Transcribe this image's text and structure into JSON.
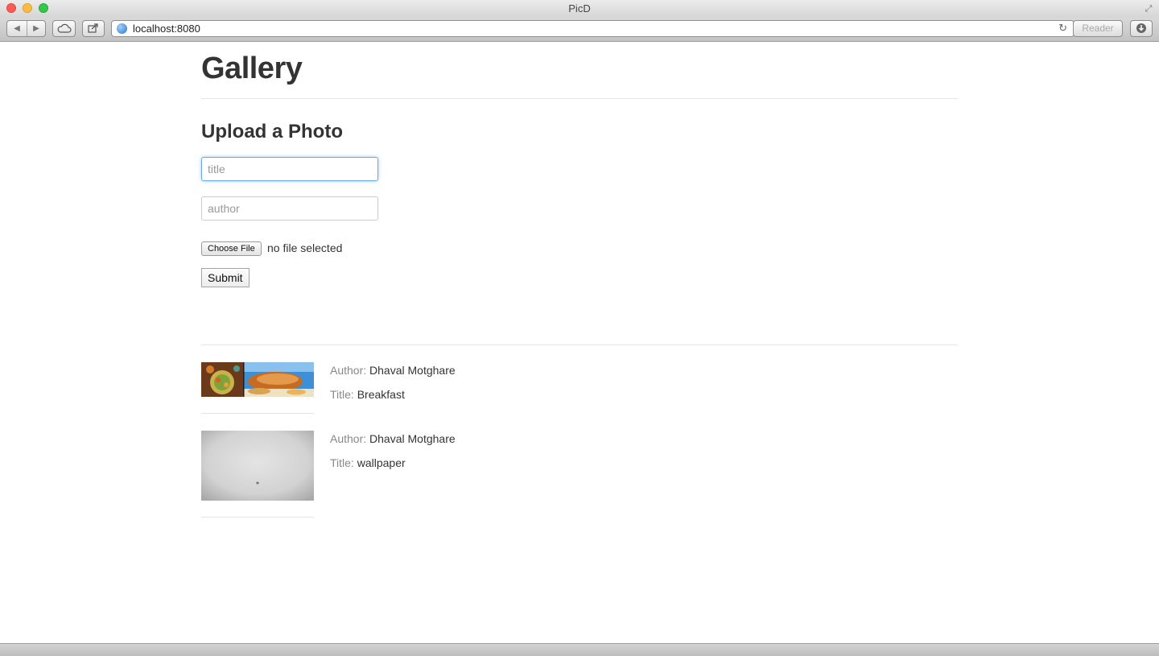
{
  "window": {
    "title": "PicD"
  },
  "browser": {
    "url": "localhost:8080",
    "reader_label": "Reader"
  },
  "page": {
    "title": "Gallery",
    "upload": {
      "heading": "Upload a Photo",
      "title_placeholder": "title",
      "author_placeholder": "author",
      "choose_file_label": "Choose File",
      "file_status": "no file selected",
      "submit_label": "Submit"
    },
    "photos": [
      {
        "author_label": "Author:",
        "author": "Dhaval Motghare",
        "title_label": "Title:",
        "title": "Breakfast"
      },
      {
        "author_label": "Author:",
        "author": "Dhaval Motghare",
        "title_label": "Title:",
        "title": "wallpaper"
      }
    ]
  },
  "icons": {
    "back": "chevron-left-icon",
    "forward": "chevron-right-icon",
    "icloud": "cloud-icon",
    "share": "share-icon",
    "site": "globe-icon",
    "reload": "reload-icon",
    "downloads": "download-icon",
    "fullscreen": "fullscreen-icon"
  },
  "colors": {
    "focus_ring": "#6fa8e6",
    "label_gray": "#888888",
    "text": "#333333"
  }
}
